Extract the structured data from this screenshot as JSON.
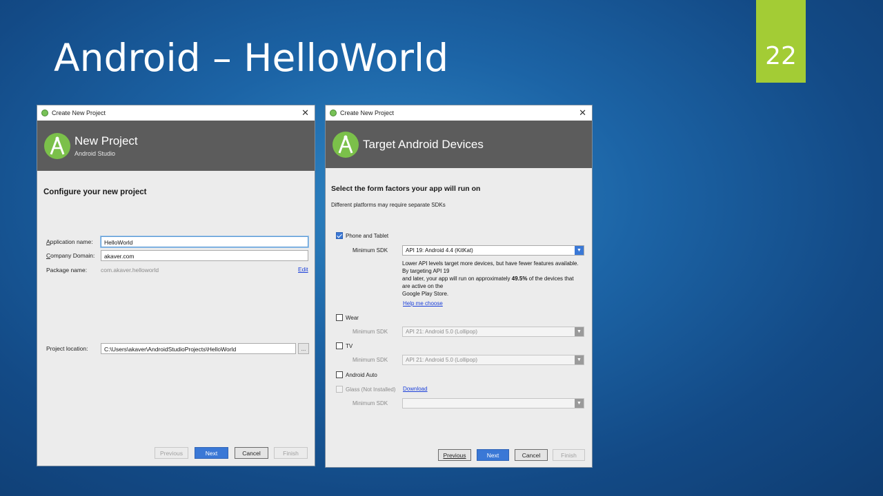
{
  "slide": {
    "title": "Android – HelloWorld",
    "page_number": "22",
    "accent_color": "#a3cc35"
  },
  "dialog1": {
    "window_title": "Create New Project",
    "banner_title": "New Project",
    "banner_subtitle": "Android Studio",
    "heading": "Configure your new project",
    "app_name_label_u": "A",
    "app_name_label_rest": "pplication name:",
    "app_name_value": "HelloWorld",
    "company_label_u": "C",
    "company_label_rest": "ompany Domain:",
    "company_value": "akaver.com",
    "package_label": "Package name:",
    "package_value": "com.akaver.helloworld",
    "edit_link": "Edit",
    "location_label": "Project location:",
    "location_value": "C:\\Users\\akaver\\AndroidStudioProjects\\HelloWorld",
    "browse_label": "...",
    "buttons": {
      "previous": "Previous",
      "next": "Next",
      "cancel": "Cancel",
      "finish": "Finish"
    }
  },
  "dialog2": {
    "window_title": "Create New Project",
    "banner_title": "Target Android Devices",
    "heading": "Select the form factors your app will run on",
    "subheading": "Different platforms may require separate SDKs",
    "phone_label": "Phone and Tablet",
    "min_sdk_label": "Minimum SDK",
    "phone_sdk": "API 19: Android 4.4 (KitKat)",
    "info_line1": "Lower API levels target more devices, but have fewer features available.",
    "info_line2": "By targeting API 19",
    "info_line3_a": "and later, your app will run on approximately ",
    "info_line3_b": "49.5%",
    "info_line3_c": " of the devices that",
    "info_line4": "are active on the",
    "info_line5": "Google Play Store.",
    "help_link": "Help me choose",
    "wear_label": "Wear",
    "wear_sdk": "API 21: Android 5.0 (Lollipop)",
    "tv_label": "TV",
    "tv_sdk": "API 21: Android 5.0 (Lollipop)",
    "auto_label": "Android Auto",
    "glass_label": "Glass (Not Installed)",
    "download_link": "Download",
    "buttons": {
      "previous": "Previous",
      "next": "Next",
      "cancel": "Cancel",
      "finish": "Finish"
    }
  }
}
